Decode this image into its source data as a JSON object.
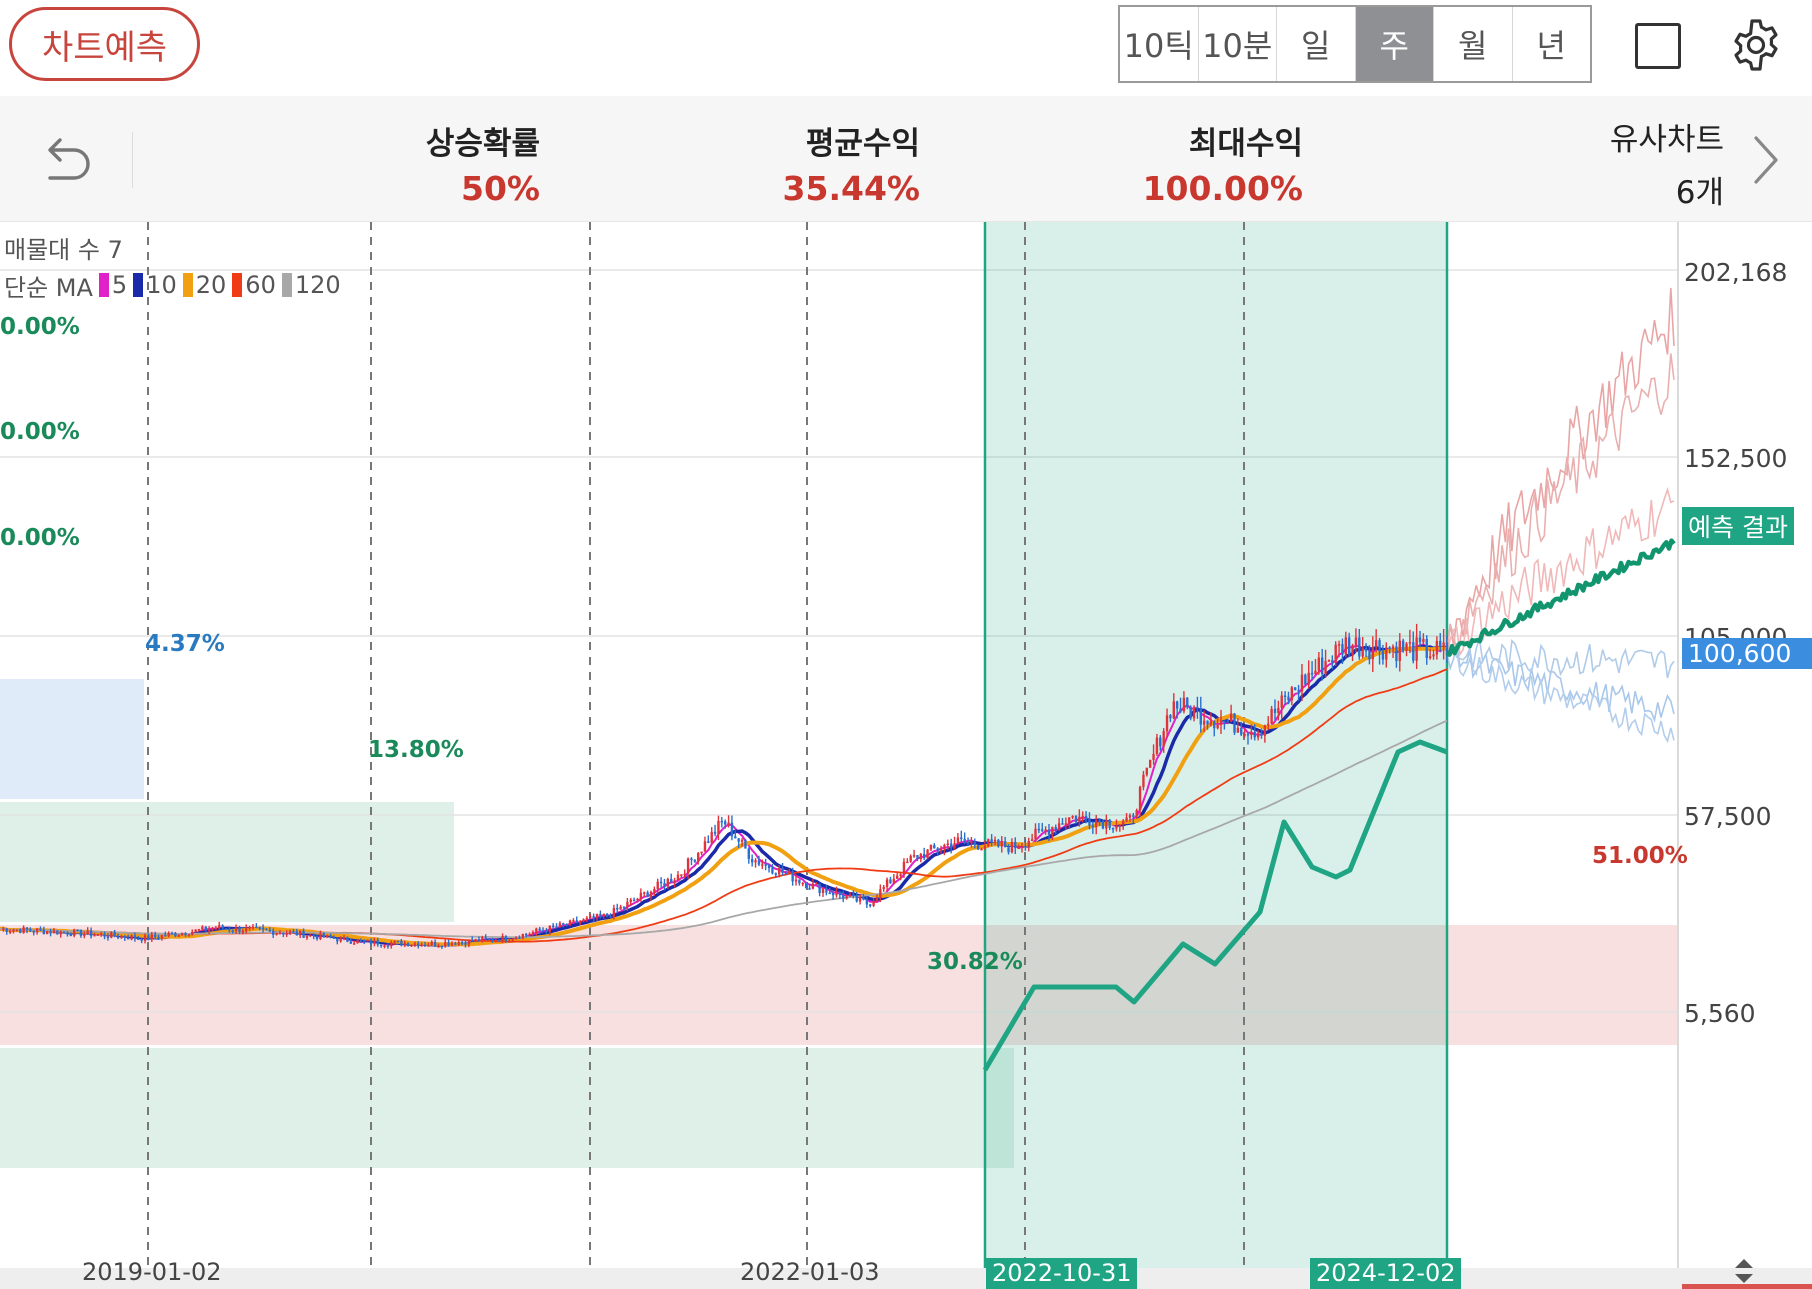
{
  "topbar": {
    "predict_button": "차트예측",
    "periods": [
      "10틱",
      "10분",
      "일",
      "주",
      "월",
      "년"
    ],
    "active_period": "주"
  },
  "stats": {
    "rise_prob_label": "상승확률",
    "rise_prob_value": "50%",
    "avg_return_label": "평균수익",
    "avg_return_value": "35.44%",
    "max_return_label": "최대수익",
    "max_return_value": "100.00%",
    "similar_label": "유사차트",
    "similar_count": "6개"
  },
  "legend": {
    "volume_profile_label": "매물대 수 7",
    "ma_label": "단순 MA",
    "ma_periods": [
      {
        "period": "5",
        "color": "#e020c8"
      },
      {
        "period": "10",
        "color": "#1a2aa8"
      },
      {
        "period": "20",
        "color": "#f0a010"
      },
      {
        "period": "60",
        "color": "#f03c14"
      },
      {
        "period": "120",
        "color": "#a8a8a8"
      }
    ]
  },
  "volume_profile": [
    {
      "label": "0.00%",
      "color": "#1a8a5a",
      "width_frac": 0.0
    },
    {
      "label": "0.00%",
      "color": "#1a8a5a",
      "width_frac": 0.0
    },
    {
      "label": "0.00%",
      "color": "#1a8a5a",
      "width_frac": 0.0
    },
    {
      "label": "4.37%",
      "color": "#2a7ac0",
      "width_frac": 0.0857,
      "fill": "#dfebf9"
    },
    {
      "label": "13.80%",
      "color": "#1a8a5a",
      "width_frac": 0.2706,
      "fill": "#dff0e8"
    },
    {
      "label": "51.00%",
      "color": "#c8382f",
      "width_frac": 1.0,
      "fill": "#f8e0e0"
    },
    {
      "label": "30.82%",
      "color": "#1a8a5a",
      "width_frac": 0.6043,
      "fill": "#dff0e8"
    }
  ],
  "price_axis": {
    "labels": [
      "202,168",
      "152,500",
      "105,000",
      "57,500",
      "5,560"
    ],
    "current_price": "100,600",
    "current_color": "#3b8de0",
    "forecast_label": "예측 결과",
    "forecast_color": "#1fa584"
  },
  "time_axis": {
    "labels": [
      "2019-01-02",
      "2022-01-03"
    ],
    "pattern_start": "2022-10-31",
    "pattern_end": "2024-12-02"
  },
  "chart_data": {
    "type": "candlestick",
    "ylim": [
      5560,
      202168
    ],
    "y_ticks": [
      5560,
      57500,
      105000,
      152500,
      202168
    ],
    "ma_periods": [
      5,
      10,
      20,
      60,
      120
    ],
    "pattern_range": [
      "2022-10-31",
      "2024-12-02"
    ],
    "current_price": 100600,
    "forecast_price": 130000,
    "approx_close_path": [
      [
        0,
        27500
      ],
      [
        0.05,
        26500
      ],
      [
        0.1,
        25000
      ],
      [
        0.15,
        27800
      ],
      [
        0.2,
        26500
      ],
      [
        0.25,
        24000
      ],
      [
        0.3,
        23500
      ],
      [
        0.35,
        25000
      ],
      [
        0.42,
        31000
      ],
      [
        0.47,
        42000
      ],
      [
        0.5,
        56000
      ],
      [
        0.52,
        46000
      ],
      [
        0.56,
        39000
      ],
      [
        0.6,
        34000
      ],
      [
        0.63,
        46000
      ],
      [
        0.66,
        50500
      ],
      [
        0.7,
        49000
      ],
      [
        0.74,
        57000
      ],
      [
        0.78,
        55000
      ],
      [
        0.81,
        87000
      ],
      [
        0.84,
        83000
      ],
      [
        0.87,
        80000
      ],
      [
        0.9,
        93000
      ],
      [
        0.93,
        103000
      ],
      [
        1.0,
        100600
      ]
    ],
    "similar_paths_count": 6
  }
}
